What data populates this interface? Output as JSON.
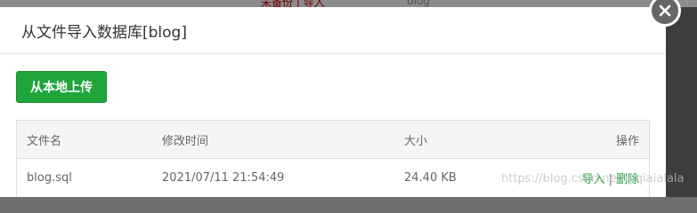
{
  "modal": {
    "title": "从文件导入数据库[blog]",
    "upload_button": "从本地上传"
  },
  "table": {
    "headers": {
      "name": "文件名",
      "time": "修改时间",
      "size": "大小",
      "actions": "操作"
    },
    "rows": [
      {
        "name": "blog.sql",
        "time": "2021/07/11 21:54:49",
        "size": "24.40 KB",
        "import": "导入",
        "separator": "|",
        "delete": "删除"
      }
    ]
  },
  "background": {
    "partial_text_1": "未备份 | 导入",
    "partial_text_2": "blog"
  },
  "watermark": "https://blog.csdn.net/qiqiaialala",
  "colors": {
    "accent": "#20a53a",
    "overlay": "#6f6f6f"
  }
}
